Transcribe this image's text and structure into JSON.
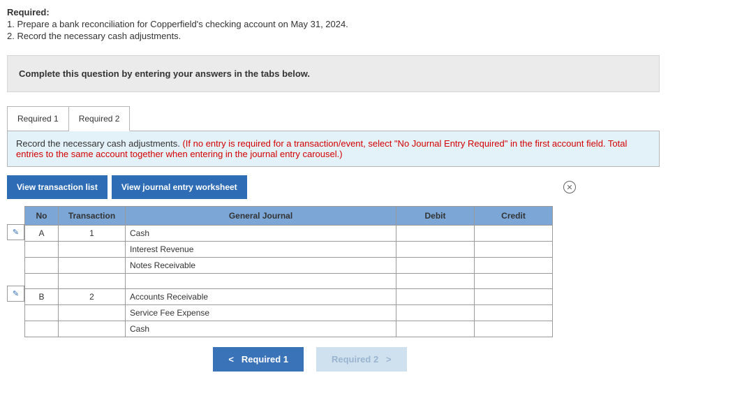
{
  "required": {
    "heading": "Required:",
    "items": [
      "1. Prepare a bank reconciliation for Copperfield's checking account on May 31, 2024.",
      "2. Record the necessary cash adjustments."
    ]
  },
  "instruction": "Complete this question by entering your answers in the tabs below.",
  "tabs": [
    {
      "label": "Required 1"
    },
    {
      "label": "Required 2"
    }
  ],
  "prompt": {
    "black": "Record the necessary cash adjustments. ",
    "red": "(If no entry is required for a transaction/event, select \"No Journal Entry Required\" in the first account field. Total entries to the same account together when entering in the journal entry carousel.)"
  },
  "buttons": {
    "view_tx": "View transaction list",
    "view_ws": "View journal entry worksheet"
  },
  "table": {
    "headers": {
      "no": "No",
      "transaction": "Transaction",
      "general_journal": "General Journal",
      "debit": "Debit",
      "credit": "Credit"
    },
    "rows": [
      {
        "edit": true,
        "no": "A",
        "tx": "1",
        "gj": "Cash",
        "debit": "",
        "credit": ""
      },
      {
        "edit": false,
        "no": "",
        "tx": "",
        "gj": "Interest Revenue",
        "debit": "",
        "credit": ""
      },
      {
        "edit": false,
        "no": "",
        "tx": "",
        "gj": "Notes Receivable",
        "debit": "",
        "credit": ""
      },
      {
        "edit": false,
        "no": "",
        "tx": "",
        "gj": "",
        "debit": "",
        "credit": ""
      },
      {
        "edit": true,
        "no": "B",
        "tx": "2",
        "gj": "Accounts Receivable",
        "debit": "",
        "credit": ""
      },
      {
        "edit": false,
        "no": "",
        "tx": "",
        "gj": "Service Fee Expense",
        "debit": "",
        "credit": ""
      },
      {
        "edit": false,
        "no": "",
        "tx": "",
        "gj": "Cash",
        "debit": "",
        "credit": ""
      }
    ]
  },
  "nav": {
    "prev": "Required 1",
    "next": "Required 2"
  },
  "icons": {
    "pencil": "✎",
    "close": "✕",
    "chev_left": "<",
    "chev_right": ">"
  }
}
